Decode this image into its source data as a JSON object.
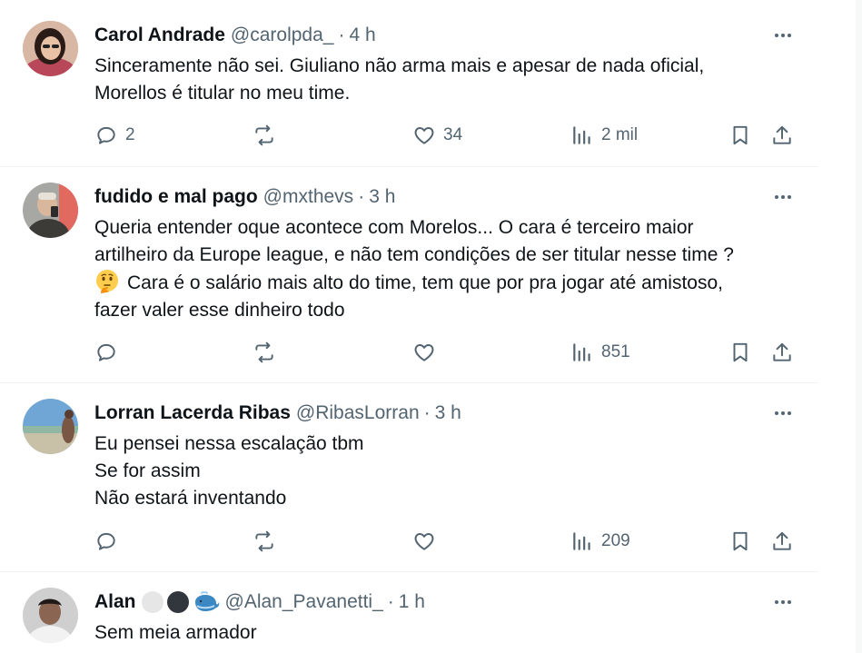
{
  "tweets": [
    {
      "name": "Carol Andrade",
      "handle": "@carolpda_",
      "sep": "·",
      "time": "4 h",
      "lines": [
        "Sinceramente não sei. Giuliano não arma mais e apesar de nada oficial,",
        "Morellos é titular no meu time."
      ],
      "replies": "2",
      "retweets": "",
      "likes": "34",
      "views": "2 mil"
    },
    {
      "name": "fudido e mal pago",
      "handle": "@mxthevs",
      "sep": "·",
      "time": "3 h",
      "lines": [
        "Queria entender oque acontece com Morelos... O cara é terceiro maior",
        "artilheiro da Europe league, e não tem condições de ser titular nesse time ?",
        "Cara é o salário mais alto do time, tem que por pra jogar até amistoso,",
        "fazer valer esse dinheiro todo"
      ],
      "emoji": "thinking-face-emoji",
      "replies": "",
      "retweets": "",
      "likes": "",
      "views": "851"
    },
    {
      "name": "Lorran Lacerda Ribas",
      "handle": "@RibasLorran",
      "sep": "·",
      "time": "3 h",
      "lines": [
        "Eu pensei nessa escalação tbm",
        "Se for assim",
        "Não estará inventando"
      ],
      "replies": "",
      "retweets": "",
      "likes": "",
      "views": "209"
    },
    {
      "name": "Alan",
      "handle": "@Alan_Pavanetti_",
      "sep": "·",
      "time": "1 h",
      "badges": [
        "white-circle-emoji",
        "black-circle-emoji",
        "whale-emoji"
      ],
      "lines": [
        "Sem meia armador"
      ]
    }
  ],
  "icons": {
    "more": "more-horizontal-icon",
    "reply": "reply-icon",
    "retweet": "retweet-icon",
    "like": "heart-icon",
    "views": "views-chart-icon",
    "bookmark": "bookmark-icon",
    "share": "share-icon"
  },
  "colors": {
    "text": "#0f1419",
    "secondary": "#536471",
    "border": "#eff3f4"
  }
}
